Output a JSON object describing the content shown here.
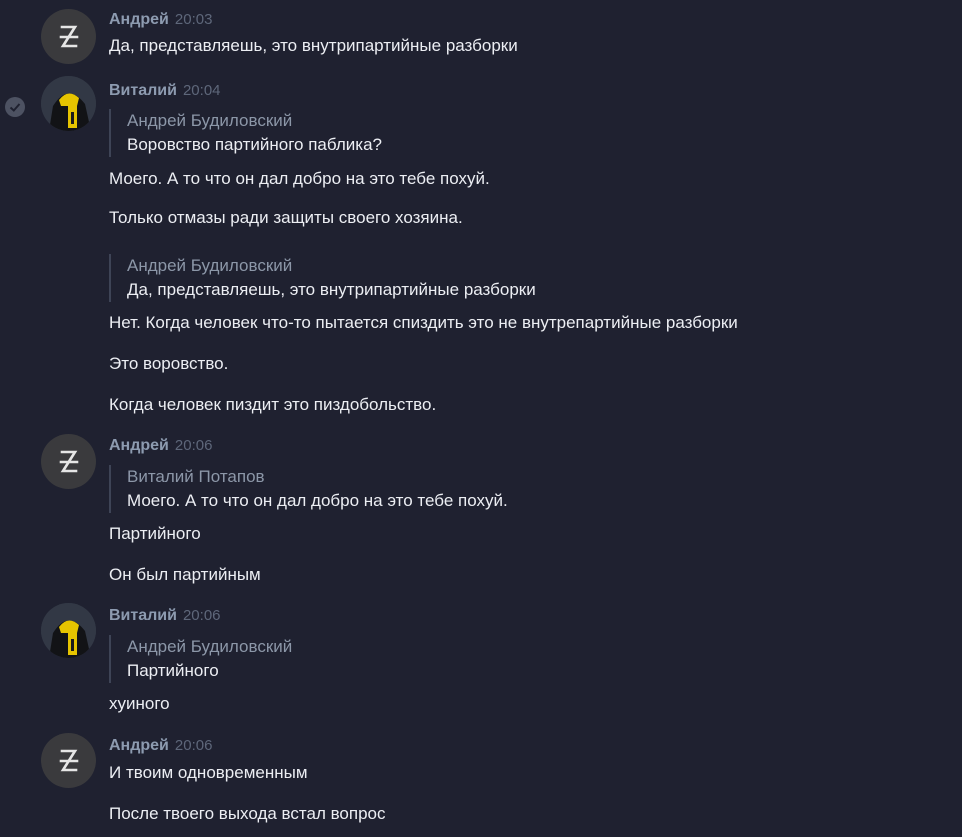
{
  "messages": [
    {
      "author": "Андрей",
      "time": "20:03",
      "lines": [
        "Да, представляешь, это внутрипартийные разборки"
      ]
    },
    {
      "author": "Виталий",
      "time": "20:04",
      "quote1": {
        "author": "Андрей Будиловский",
        "text": "Воровство партийного паблика?"
      },
      "lines1": [
        "Моего. А то что он дал добро на это тебе похуй.",
        "Только отмазы ради защиты своего хозяина."
      ],
      "quote2": {
        "author": "Андрей Будиловский",
        "text": "Да, представляешь, это внутрипартийные разборки"
      },
      "lines2": [
        "Нет. Когда человек что-то пытается спиздить это не внутрепартийные разборки",
        "Это воровство.",
        "Когда человек пиздит это пиздобольство."
      ]
    },
    {
      "author": "Андрей",
      "time": "20:06",
      "quote": {
        "author": "Виталий Потапов",
        "text": "Моего. А то что он дал добро на это тебе похуй."
      },
      "lines": [
        "Партийного",
        "Он был партийным"
      ]
    },
    {
      "author": "Виталий",
      "time": "20:06",
      "quote": {
        "author": "Андрей Будиловский",
        "text": "Партийного"
      },
      "lines": [
        "хуиного"
      ]
    },
    {
      "author": "Андрей",
      "time": "20:06",
      "lines": [
        "И твоим одновременным",
        "После твоего выхода встал вопрос"
      ]
    }
  ],
  "icons": {
    "andrei_avatar": "letter-z-logo-avatar",
    "vitaly_avatar": "hooded-figure-yellow-avatar",
    "read_status": "checkmark-circle-icon"
  },
  "colors": {
    "background": "#1f2130",
    "author": "#8d9bb0",
    "time": "#5e677a",
    "text": "#eceef3",
    "quote_bar": "#3e4456"
  }
}
